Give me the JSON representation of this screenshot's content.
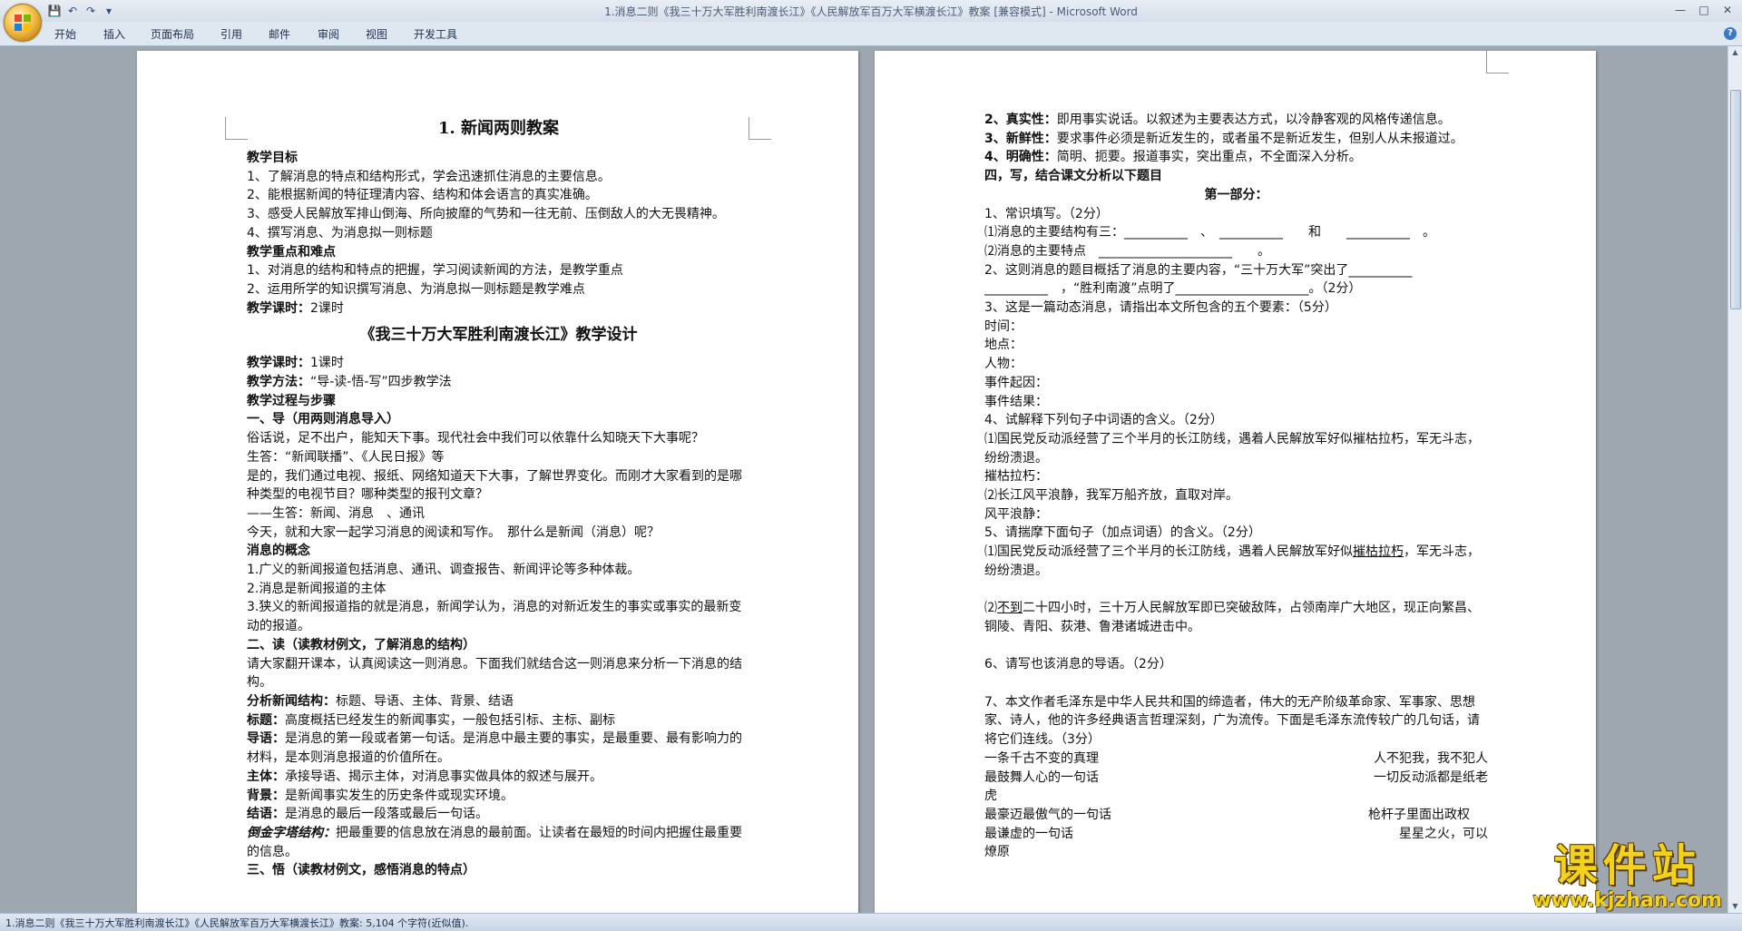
{
  "window": {
    "title": "1.消息二则《我三十万大军胜利南渡长江》《人民解放军百万大军横渡长江》教案 [兼容模式] - Microsoft Word",
    "qat_save": "💾",
    "qat_undo": "↶",
    "qat_redo": "↷",
    "qat_more": "▾",
    "minimize": "—",
    "maximize": "□",
    "close": "✕"
  },
  "ribbon": {
    "tabs": [
      "开始",
      "插入",
      "页面布局",
      "引用",
      "邮件",
      "审阅",
      "视图",
      "开发工具"
    ],
    "help": "?"
  },
  "left_page": {
    "title": "1. 新闻两则教案",
    "objectives_h": "教学目标",
    "obj1": "1、了解消息的特点和结构形式，学会迅速抓住消息的主要信息。",
    "obj2": "2、能根据新闻的特征理清内容、结构和体会语言的真实准确。",
    "obj3": "3、感受人民解放军排山倒海、所向披靡的气势和一往无前、压倒敌人的大无畏精神。",
    "obj4": "4、撰写消息、为消息拟一则标题",
    "keypoint_h": "教学重点和难点",
    "key1": "1、对消息的结构和特点的把握，学习阅读新闻的方法，是教学重点",
    "key2": "2、运用所学的知识撰写消息、为消息拟一则标题是教学难点",
    "hours_label": "教学课时：",
    "hours_val": "2课时",
    "design_title": "《我三十万大军胜利南渡长江》教学设计",
    "hours2_label": "教学课时：",
    "hours2_val": "1课时",
    "method_label": "教学方法：",
    "method_val": "“导-读-悟-写”四步教学法",
    "process_h": "教学过程与步骤",
    "step1_h": "一、导（用两则消息导入）",
    "p1": "俗话说，足不出户，能知天下事。现代社会中我们可以依靠什么知晓天下大事呢？",
    "p2": "生答：“新闻联播”、《人民日报》等",
    "p3": "是的，我们通过电视、报纸、网络知道天下大事，了解世界变化。而刚才大家看到的是哪种类型的电视节目？哪种类型的报刊文章？",
    "p4": "——生答：新闻、消息　、通讯",
    "p5": "今天，就和大家一起学习消息的阅读和写作。　那什么是新闻（消息）呢？",
    "concept_h": "消息的概念",
    "c1": "1.广义的新闻报道包括消息、通讯、调查报告、新闻评论等多种体裁。",
    "c2": "2.消息是新闻报道的主体",
    "c3": "3.狭义的新闻报道指的就是消息，新闻学认为，消息的对新近发生的事实或事实的最新变动的报道。",
    "step2_h": "二、读（读教材例文，了解消息的结构）",
    "r1": "请大家翻开课本，认真阅读这一则消息。下面我们就结合这一则消息来分析一下消息的结构。",
    "struct_label": "分析新闻结构：",
    "struct_val": "标题、导语、主体、背景、结语",
    "title_label": "标题：",
    "title_val": "高度概括已经发生的新闻事实，一般包括引标、主标、副标",
    "lead_label": "导语：",
    "lead_val": "是消息的第一段或者第一句话。是消息中最主要的事实，是最重要、最有影响力的材料，是本则消息报道的价值所在。",
    "body_label": "主体：",
    "body_val": "承接导语、揭示主体，对消息事实做具体的叙述与展开。",
    "bg_label": "背景：",
    "bg_val": "是新闻事实发生的历史条件或现实环境。",
    "end_label": "结语：",
    "end_val": "是消息的最后一段落或最后一句话。",
    "pyramid_label": "倒金字塔结构：",
    "pyramid_val": "把最重要的信息放在消息的最前面。让读者在最短的时间内把握住最重要的信息。",
    "step3_h": "三、悟（读教材例文，感悟消息的特点）"
  },
  "right_page": {
    "f2_label": "2、真实性：",
    "f2_val": "即用事实说话。以叙述为主要表达方式，以冷静客观的风格传递信息。",
    "f3_label": "3、新鲜性：",
    "f3_val": "要求事件必须是新近发生的，或者虽不是新近发生，但别人从未报道过。",
    "f4_label": "4、明确性：",
    "f4_val": "简明、扼要。报道事实，突出重点，不全面深入分析。",
    "s4_h": "四，写，结合课文分析以下题目",
    "part1": "第一部分：",
    "q1": "1、常识填写。（2分）",
    "q1a": "⑴消息的主要结构有三：__________　、　__________　　和　　__________　。",
    "q1b": "⑵消息的主要特点　_____________________　　。",
    "q2": "2、这则消息的题目概括了消息的主要内容，“三十万大军”突出了__________ __________　，“胜利南渡”点明了_____________________。（2分）",
    "q3": "3、这是一篇动态消息，请指出本文所包含的五个要素：（5分）",
    "e1": "时间：",
    "e2": "地点：",
    "e3": "人物：",
    "e4": "事件起因：",
    "e5": "事件结果：",
    "q4": "4、试解释下列句子中词语的含义。（2分）",
    "q4a": "⑴国民党反动派经营了三个半月的长江防线，遇着人民解放军好似摧枯拉朽，军无斗志，纷纷溃退。",
    "q4b": "摧枯拉朽：",
    "q4c": "⑵长江风平浪静，我军万船齐放，直取对岸。",
    "q4d": "风平浪静：",
    "q5": "5、请揣摩下面句子（加点词语）的含义。（2分）",
    "q5a_pre": "⑴国民党反动派经营了三个半月的长江防线，遇着人民解放军好似",
    "q5a_u": "摧枯拉朽",
    "q5a_post": "，军无斗志，纷纷溃退。",
    "q5b_pre": "⑵",
    "q5b_u": "不到",
    "q5b_post": "二十四小时，三十万人民解放军即已突破敌阵，占领南岸广大地区，现正向繁昌、铜陵、青阳、荻港、鲁港诸城进击中。",
    "q6": "6、请写也该消息的导语。（2分）",
    "q7": "7、本文作者毛泽东是中华人民共和国的缔造者，伟大的无产阶级革命家、军事家、思想家、诗人，他的许多经典语言哲理深刻，广为流传。下面是毛泽东流传较广的几句话，请将它们连线。（3分）",
    "m1l": "一条千古不变的真理",
    "m1r": "人不犯我，我不犯人",
    "m2l": "最鼓舞人心的一句话",
    "m2r": "一切反动派都是纸老",
    "m2c": "虎",
    "m3l": "最豪迈最傲气的一句话",
    "m3r": "枪杆子里面出政权",
    "m4l": "最谦虚的一句话",
    "m4r": "星星之火，可以",
    "m4c": "燎原"
  },
  "status": {
    "text": "1.消息二则《我三十万大军胜利南渡长江》《人民解放军百万大军横渡长江》教案: 5,104 个字符(近似值)."
  },
  "watermark": {
    "big": "课件站",
    "small": "www.kjzhan.com"
  },
  "colors": {
    "accent": "#3a78c8",
    "watermark": "#f2d21a"
  }
}
